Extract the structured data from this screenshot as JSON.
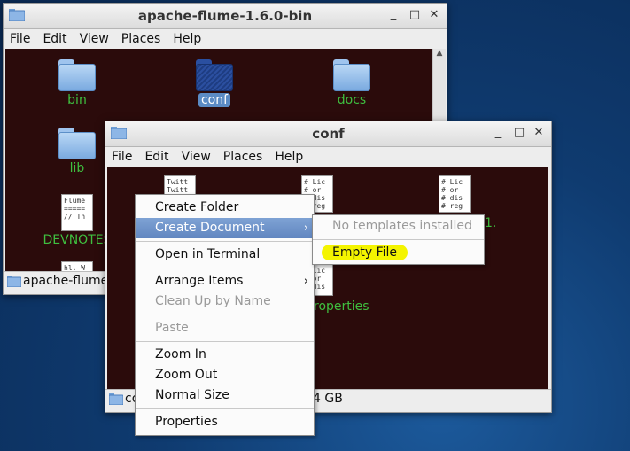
{
  "window_back": {
    "title": "apache-flume-1.6.0-bin",
    "menu": [
      "File",
      "Edit",
      "View",
      "Places",
      "Help"
    ],
    "items": [
      {
        "label": "bin"
      },
      {
        "label": "conf"
      },
      {
        "label": "docs"
      },
      {
        "label": "lib"
      },
      {
        "label": "DEVNOTES",
        "preview": "Flume\n=====\n// Th"
      },
      {
        "preview": "hl. W"
      }
    ],
    "status": "apache-flume-"
  },
  "window_front": {
    "title": "conf",
    "menu": [
      "File",
      "Edit",
      "View",
      "Places",
      "Help"
    ],
    "items": [
      {
        "preview": "Twitt\nTwitt"
      },
      {
        "preview": "# Lic\n# or\n# dis\n# reg"
      },
      {
        "preview": "# Lic\n# or\n# dis\n# reg",
        "label_tail": "1."
      },
      {
        "preview": "# Lic\n# or\n# dis",
        "label_tail": "roperties"
      }
    ],
    "status_left": "co",
    "status_right": "4 GB"
  },
  "context_menu": {
    "items": [
      {
        "label": "Create Folder"
      },
      {
        "label": "Create Document"
      },
      {
        "label": "Open in Terminal"
      },
      {
        "label": "Arrange Items"
      },
      {
        "label": "Clean Up by Name"
      },
      {
        "label": "Paste"
      },
      {
        "label": "Zoom In"
      },
      {
        "label": "Zoom Out"
      },
      {
        "label": "Normal Size"
      },
      {
        "label": "Properties"
      }
    ]
  },
  "submenu": {
    "no_templates": "No templates installed",
    "empty_file": "Empty File"
  },
  "colors": {
    "highlight_yellow": "#f4f400",
    "menu_highlight": "#6d90c8",
    "label_green": "#3fbf3f",
    "content_bg": "#2b0b0b"
  }
}
